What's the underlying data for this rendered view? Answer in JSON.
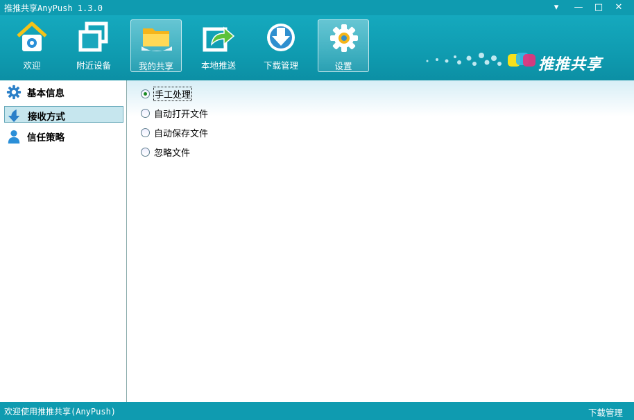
{
  "window": {
    "title": "推推共享AnyPush 1.3.0"
  },
  "titlebar_buttons": {
    "menu": "▾",
    "minimize": "—",
    "maximize": "□",
    "close": "✕"
  },
  "toolbar": {
    "items": [
      {
        "label": "欢迎",
        "icon": "home-icon"
      },
      {
        "label": "附近设备",
        "icon": "devices-icon"
      },
      {
        "label": "我的共享",
        "icon": "folder-icon"
      },
      {
        "label": "本地推送",
        "icon": "push-icon"
      },
      {
        "label": "下载管理",
        "icon": "download-icon"
      },
      {
        "label": "设置",
        "icon": "gear-icon"
      }
    ],
    "selected": [
      "我的共享",
      "设置"
    ]
  },
  "brand": {
    "text": "推推共享"
  },
  "sidebar": {
    "items": [
      {
        "label": "基本信息",
        "icon": "gear-icon"
      },
      {
        "label": "接收方式",
        "icon": "download-arrow-icon",
        "selected": true
      },
      {
        "label": "信任策略",
        "icon": "user-icon"
      }
    ]
  },
  "options": {
    "items": [
      {
        "label": "手工处理",
        "checked": true
      },
      {
        "label": "自动打开文件",
        "checked": false
      },
      {
        "label": "自动保存文件",
        "checked": false
      },
      {
        "label": "忽略文件",
        "checked": false
      }
    ]
  },
  "statusbar": {
    "left": "欢迎使用推推共享(AnyPush)",
    "right": "下载管理"
  },
  "colors": {
    "frame": "#0f9bb0",
    "selected_sidebar": "#c6e6ee",
    "radio_dot": "#1a8a22"
  }
}
